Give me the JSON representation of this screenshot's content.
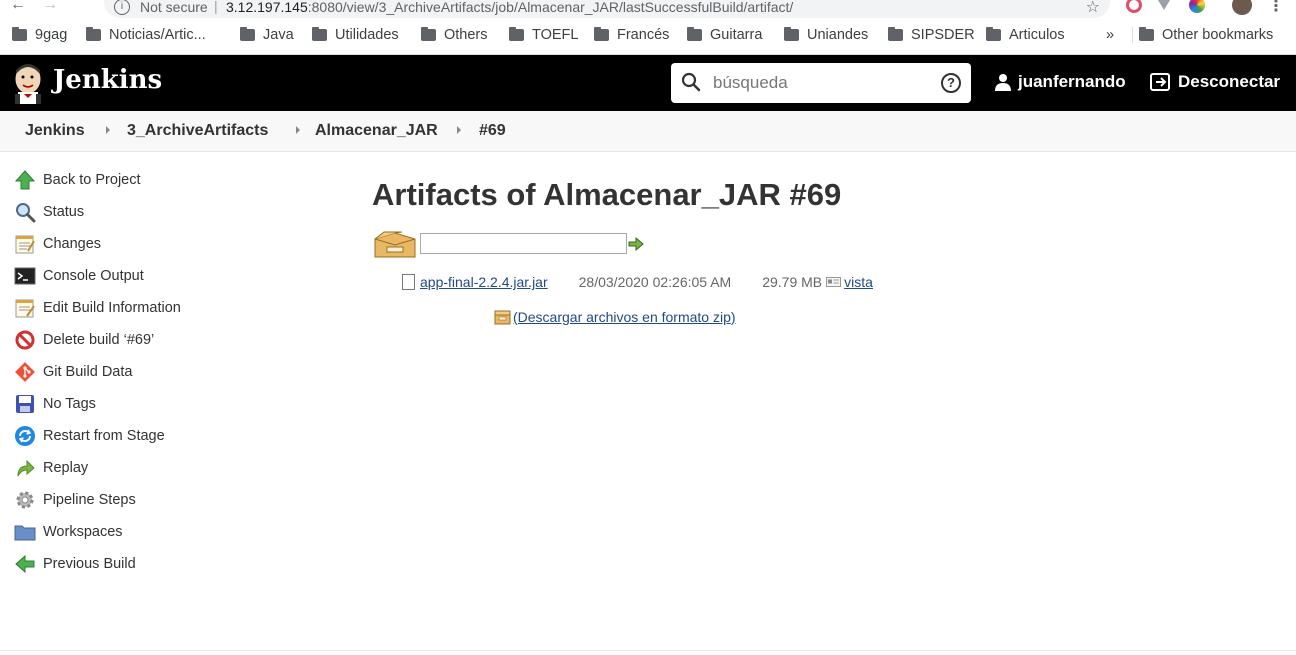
{
  "browser": {
    "not_secure": "Not secure",
    "url_host": "3.12.197.145",
    "url_rest": ":8080/view/3_ArchiveArtifacts/job/Almacenar_JAR/lastSuccessfulBuild/artifact/",
    "bookmarks": [
      "9gag",
      "Noticias/Artic...",
      "Java",
      "Utilidades",
      "Others",
      "TOEFL",
      "Francés",
      "Guitarra",
      "Uniandes",
      "SIPSDER",
      "Articulos"
    ],
    "overflow": "»",
    "other_bookmarks": "Other bookmarks"
  },
  "header": {
    "title": "Jenkins",
    "search_placeholder": "búsqueda",
    "help": "?",
    "username": "juanfernando",
    "logout": "Desconectar"
  },
  "breadcrumb": [
    "Jenkins",
    "3_ArchiveArtifacts",
    "Almacenar_JAR",
    "#69"
  ],
  "sidebar": {
    "items": [
      {
        "label": "Back to Project",
        "icon": "up-arrow-icon"
      },
      {
        "label": "Status",
        "icon": "magnifier-icon"
      },
      {
        "label": "Changes",
        "icon": "notepad-icon"
      },
      {
        "label": "Console Output",
        "icon": "terminal-icon"
      },
      {
        "label": "Edit Build Information",
        "icon": "notepad-edit-icon"
      },
      {
        "label": "Delete build ‘#69’",
        "icon": "no-entry-icon"
      },
      {
        "label": "Git Build Data",
        "icon": "git-icon"
      },
      {
        "label": "No Tags",
        "icon": "save-icon"
      },
      {
        "label": "Restart from Stage",
        "icon": "restart-icon"
      },
      {
        "label": "Replay",
        "icon": "replay-arrow-icon"
      },
      {
        "label": "Pipeline Steps",
        "icon": "gear-icon"
      },
      {
        "label": "Workspaces",
        "icon": "folder-icon"
      },
      {
        "label": "Previous Build",
        "icon": "left-arrow-icon"
      }
    ]
  },
  "main": {
    "title": "Artifacts of Almacenar_JAR #69",
    "filter_value": "",
    "artifact": {
      "name": "app-final-2.2.4.jar.jar",
      "date": "28/03/2020 02:26:05 AM",
      "size": "29.79 MB",
      "view": "vista"
    },
    "zip_link": "(Descargar archivos en formato zip)"
  }
}
